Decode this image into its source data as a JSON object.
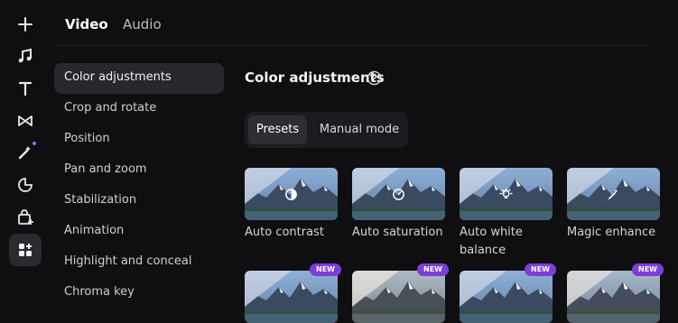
{
  "rail": {
    "icons": [
      "plus-icon",
      "music-note-icon",
      "text-icon",
      "transition-icon",
      "magic-wand-icon",
      "sticker-icon",
      "plugin-bag-icon",
      "apps-grid-icon"
    ]
  },
  "tabs": [
    {
      "label": "Video",
      "active": true
    },
    {
      "label": "Audio",
      "active": false
    }
  ],
  "menu": [
    {
      "label": "Color adjustments",
      "active": true
    },
    {
      "label": "Crop and rotate",
      "active": false
    },
    {
      "label": "Position",
      "active": false
    },
    {
      "label": "Pan and zoom",
      "active": false
    },
    {
      "label": "Stabilization",
      "active": false
    },
    {
      "label": "Animation",
      "active": false
    },
    {
      "label": "Highlight and conceal",
      "active": false
    },
    {
      "label": "Chroma key",
      "active": false
    }
  ],
  "main": {
    "title": "Color adjustments",
    "segmented": {
      "presets": "Presets",
      "manual": "Manual mode",
      "selected": "Presets"
    },
    "cards": [
      {
        "label": "Auto contrast",
        "icon": "contrast-icon"
      },
      {
        "label": "Auto saturation",
        "icon": "saturation-icon"
      },
      {
        "label": "Auto white balance",
        "icon": "lightbulb-icon"
      },
      {
        "label": "Magic enhance",
        "icon": "magic-wand-icon"
      }
    ],
    "new_badge": "NEW",
    "new_cards_count": 4
  },
  "colors": {
    "accent": "#7b3fd6",
    "background": "#0f0f11",
    "active_item": "#27272c"
  }
}
